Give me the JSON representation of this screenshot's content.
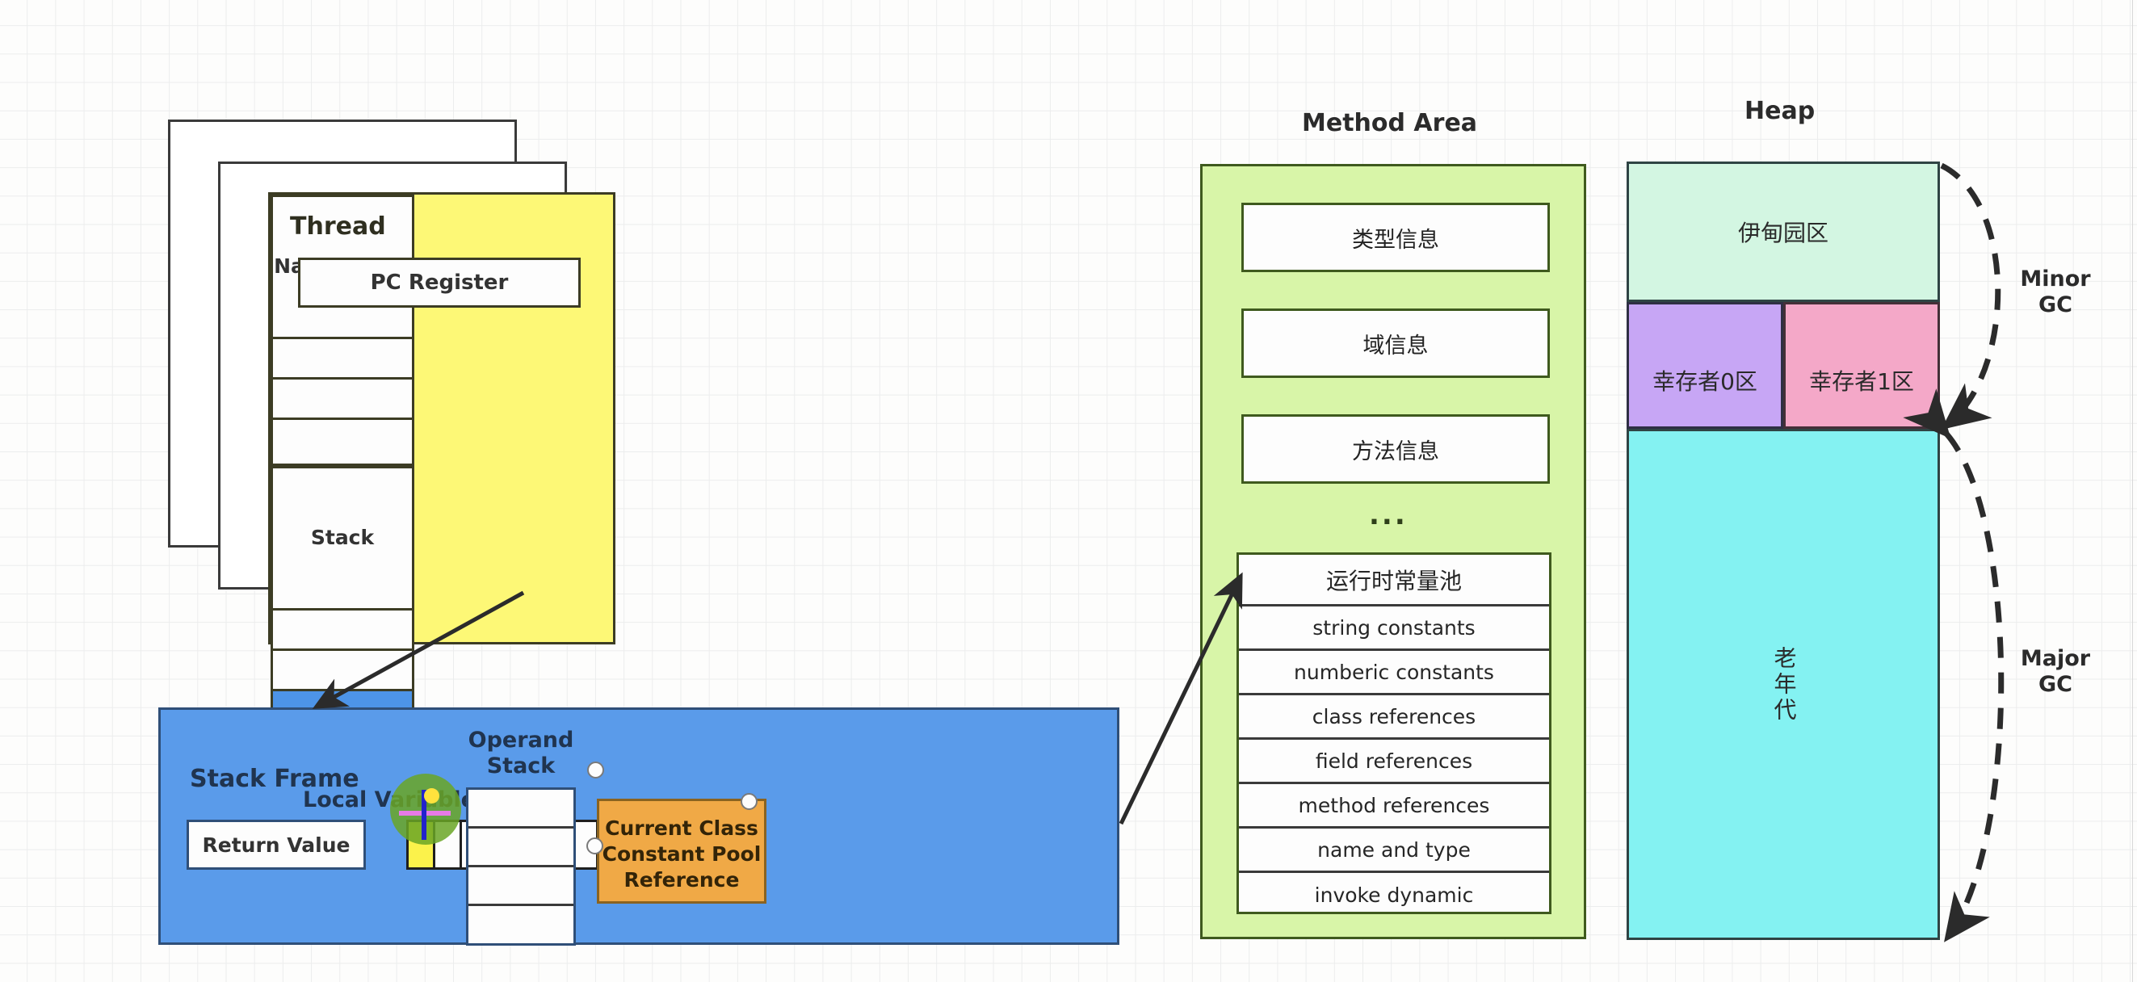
{
  "canvas": {
    "background": "#fdfdfc",
    "grid_color": "#eceded"
  },
  "titles": {
    "method_area": "Method Area",
    "heap": "Heap"
  },
  "thread": {
    "title": "Thread",
    "pc_register": "PC Register",
    "native_stack": {
      "label": "Native\nStack",
      "label_line1": "Native",
      "label_line2": "Stack",
      "slots": 3
    },
    "stack": {
      "label": "Stack",
      "slots": 3,
      "active_slot_index": 2,
      "active_color": "#4d94e8"
    },
    "card_color": "#fdf876"
  },
  "stack_frame": {
    "title": "Stack Frame",
    "return_value": "Return Value",
    "local_variables_label": "Local Variables",
    "local_variable_cells": 7,
    "selected_cell_index": 0,
    "selected_cell_color": "#fbf24b",
    "operand_stack_label_line1": "Operand",
    "operand_stack_label_line2": "Stack",
    "operand_stack_cells": 4,
    "constant_pool_ref_line1": "Current Class",
    "constant_pool_ref_line2": "Constant Pool",
    "constant_pool_ref_line3": "Reference",
    "card_color": "#5a9bea",
    "cp_ref_color": "#f0a946"
  },
  "method_area": {
    "card_color": "#d8f5a8",
    "items": [
      {
        "label": "类型信息"
      },
      {
        "label": "域信息"
      },
      {
        "label": "方法信息"
      }
    ],
    "ellipsis": "...",
    "runtime_constant_pool": {
      "header": "运行时常量池",
      "rows": [
        "string constants",
        "numberic constants",
        "class references",
        "field references",
        "method references",
        "name and type",
        "invoke dynamic"
      ]
    }
  },
  "heap": {
    "eden": {
      "label": "伊甸园区",
      "color": "#d3f6e2"
    },
    "survivor0": {
      "label": "幸存者0区",
      "color": "#c7a6f5"
    },
    "survivor1": {
      "label": "幸存者1区",
      "color": "#f4a8c8"
    },
    "old_generation": {
      "label": "老年代",
      "color": "#84f2f2"
    },
    "minor_gc": {
      "line1": "Minor",
      "line2": "GC"
    },
    "major_gc": {
      "line1": "Major",
      "line2": "GC"
    }
  },
  "cursor": {
    "halo_color": "#6aa626",
    "crosshair_horizontal_color": "#e77ae7",
    "crosshair_vertical_color": "#2222cc",
    "dot_color": "#ffe23d"
  }
}
